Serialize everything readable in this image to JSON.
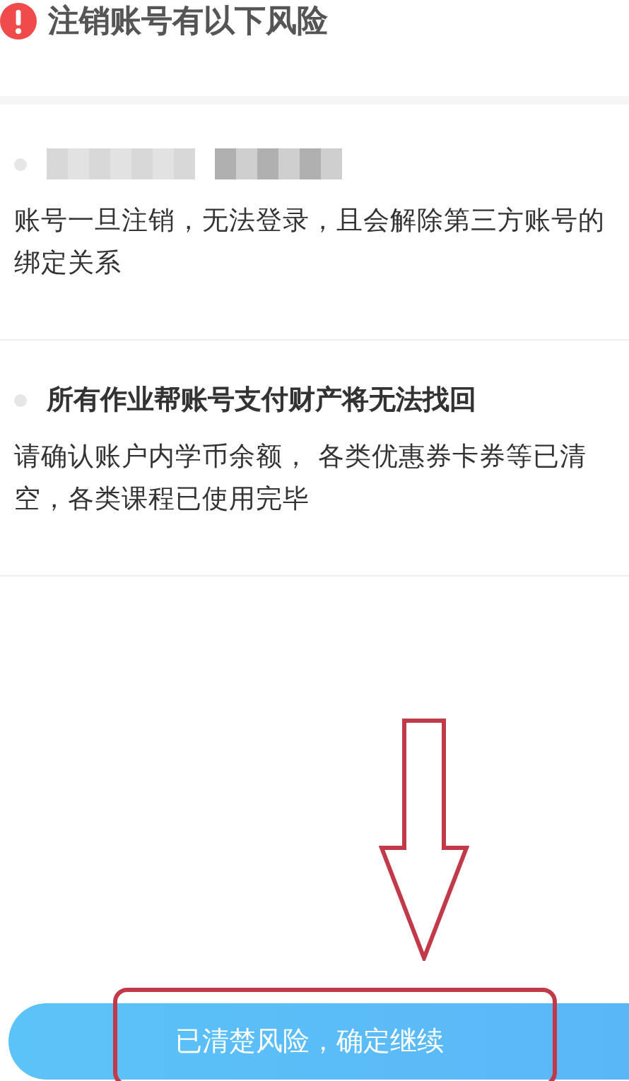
{
  "header": {
    "title": "注销账号有以下风险"
  },
  "risks": [
    {
      "kind": "redacted",
      "description": "账号一旦注销，无法登录，且会解除第三方账号的绑定关系"
    },
    {
      "kind": "titled",
      "title": "所有作业帮账号支付财产将无法找回",
      "description": "请确认账户内学币余额， 各类优惠券卡券等已清空，各类课程已使用完毕"
    }
  ],
  "confirm_button": {
    "label": "已清楚风险，确定继续"
  }
}
